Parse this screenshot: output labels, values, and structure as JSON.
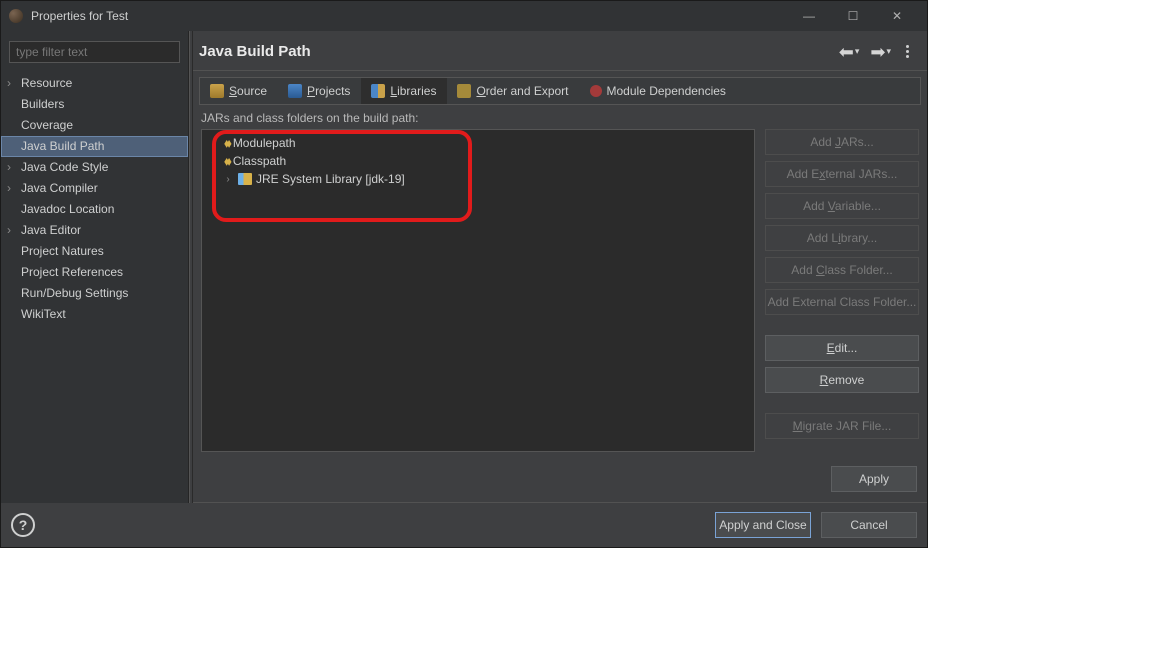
{
  "window": {
    "title": "Properties for Test"
  },
  "filter": {
    "placeholder": "type filter text"
  },
  "sidebar": {
    "items": [
      {
        "label": "Resource",
        "expandable": true
      },
      {
        "label": "Builders"
      },
      {
        "label": "Coverage"
      },
      {
        "label": "Java Build Path",
        "selected": true
      },
      {
        "label": "Java Code Style",
        "expandable": true
      },
      {
        "label": "Java Compiler",
        "expandable": true
      },
      {
        "label": "Javadoc Location"
      },
      {
        "label": "Java Editor",
        "expandable": true
      },
      {
        "label": "Project Natures"
      },
      {
        "label": "Project References"
      },
      {
        "label": "Run/Debug Settings"
      },
      {
        "label": "WikiText"
      }
    ]
  },
  "pane": {
    "title": "Java Build Path",
    "tabs": [
      {
        "icon": "icon-src",
        "prefix": "",
        "u": "S",
        "rest": "ource"
      },
      {
        "icon": "icon-proj",
        "prefix": "",
        "u": "P",
        "rest": "rojects"
      },
      {
        "icon": "icon-lib",
        "prefix": "",
        "u": "L",
        "rest": "ibraries",
        "active": true
      },
      {
        "icon": "icon-order",
        "prefix": "",
        "u": "O",
        "rest": "rder and Export"
      },
      {
        "icon": "icon-module",
        "prefix": "Module Dependencies"
      }
    ],
    "caption": "JARs and class folders on the build path:",
    "tree": {
      "modulepath": "Modulepath",
      "classpath": "Classpath",
      "jre": "JRE System Library [jdk-19]"
    },
    "buttons": {
      "add_jars": {
        "label": "Add JARs...",
        "u": "J",
        "disabled": true
      },
      "add_ext_jars": {
        "label": "Add External JARs...",
        "u": "x",
        "disabled": true
      },
      "add_variable": {
        "label": "Add Variable...",
        "u": "V",
        "disabled": true
      },
      "add_library": {
        "label": "Add Library...",
        "u": "i",
        "disabled": true
      },
      "add_class_folder": {
        "label": "Add Class Folder...",
        "u": "C",
        "disabled": true
      },
      "add_ext_class": {
        "label": "Add External Class Folder...",
        "u": "",
        "disabled": true
      },
      "edit": {
        "label": "Edit...",
        "u": "E"
      },
      "remove": {
        "label": "Remove",
        "u": "R"
      },
      "migrate": {
        "label": "Migrate JAR File...",
        "u": "M",
        "disabled": true
      }
    },
    "apply": "Apply"
  },
  "footer": {
    "apply_close": "Apply and Close",
    "cancel": "Cancel"
  }
}
